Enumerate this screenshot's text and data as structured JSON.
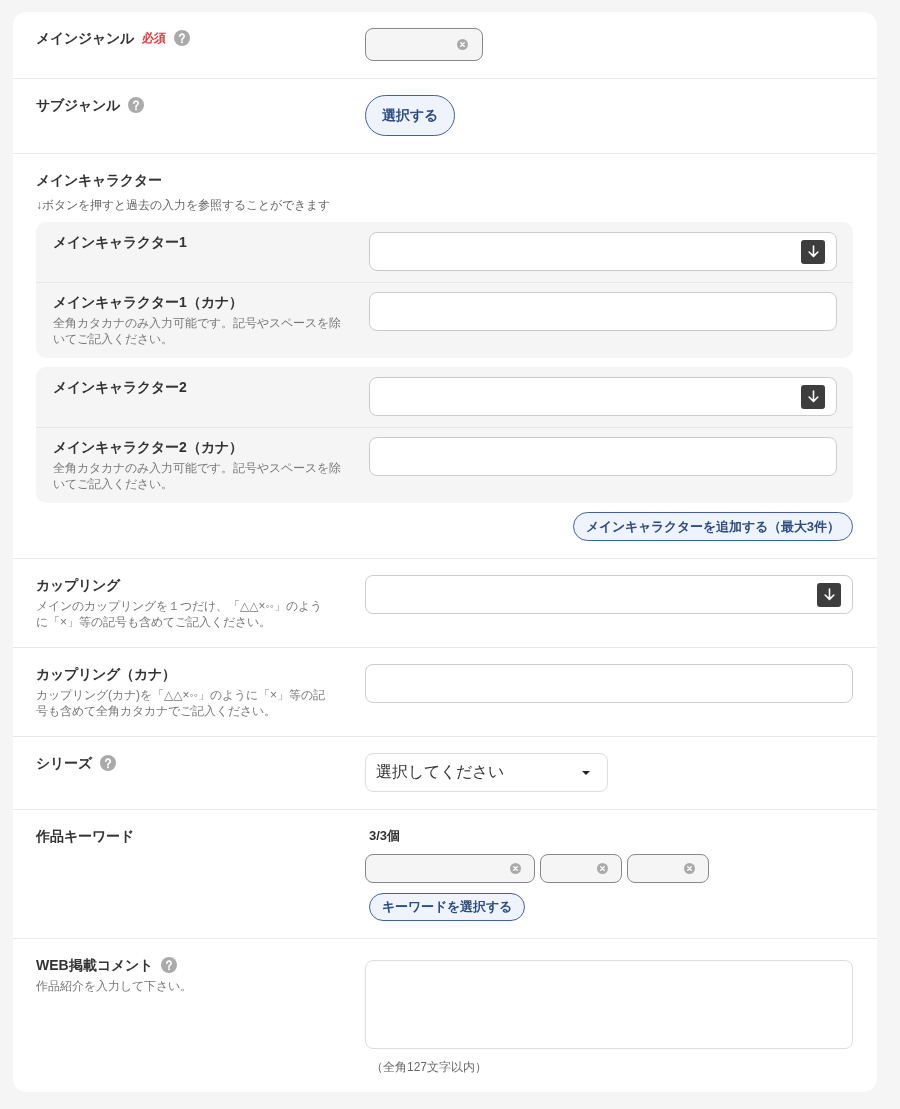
{
  "form": {
    "rows": [
      {
        "kind": "chips",
        "label": "メインジャンル",
        "badge": "必須",
        "help": true,
        "chips": [
          {
            "removable": true
          }
        ]
      },
      {
        "kind": "button",
        "label": "サブジャンル",
        "help": true,
        "button": "選択する"
      },
      {
        "kind": "characters",
        "label": "メインキャラクター",
        "note": "↓ボタンを押すと過去の入力を参照することができます",
        "groups": [
          {
            "fields": [
              {
                "label": "メインキャラクター1",
                "history_button": true
              },
              {
                "label": "メインキャラクター1（カナ）",
                "hint": "全角カタカナのみ入力可能です。記号やスペースを除いてご記入ください。",
                "history_button": false
              }
            ]
          },
          {
            "fields": [
              {
                "label": "メインキャラクター2",
                "history_button": true
              },
              {
                "label": "メインキャラクター2（カナ）",
                "hint": "全角カタカナのみ入力可能です。記号やスペースを除いてご記入ください。",
                "history_button": false
              }
            ]
          }
        ],
        "add_button": "メインキャラクターを追加する（最大3件）"
      },
      {
        "kind": "text",
        "label": "カップリング",
        "hint": "メインのカップリングを１つだけ、「△△×◦◦」のように「×」等の記号も含めてご記入ください。",
        "history_button": true
      },
      {
        "kind": "text",
        "label": "カップリング（カナ）",
        "hint": "カップリング(カナ)を「△△×◦◦」のように「×」等の記号も含めて全角カタカナでご記入ください。",
        "history_button": false
      },
      {
        "kind": "select",
        "label": "シリーズ",
        "help": true,
        "value": "選択してください"
      },
      {
        "kind": "keywords",
        "label": "作品キーワード",
        "count": "3/3個",
        "chips": [
          {
            "removable": true
          },
          {
            "removable": true
          },
          {
            "removable": true
          }
        ],
        "button": "キーワードを選択する"
      },
      {
        "kind": "textarea",
        "label": "WEB掲載コメント",
        "help": true,
        "hint": "作品紹介を入力して下さい。",
        "limit": "（全角127文字以内）"
      }
    ]
  }
}
